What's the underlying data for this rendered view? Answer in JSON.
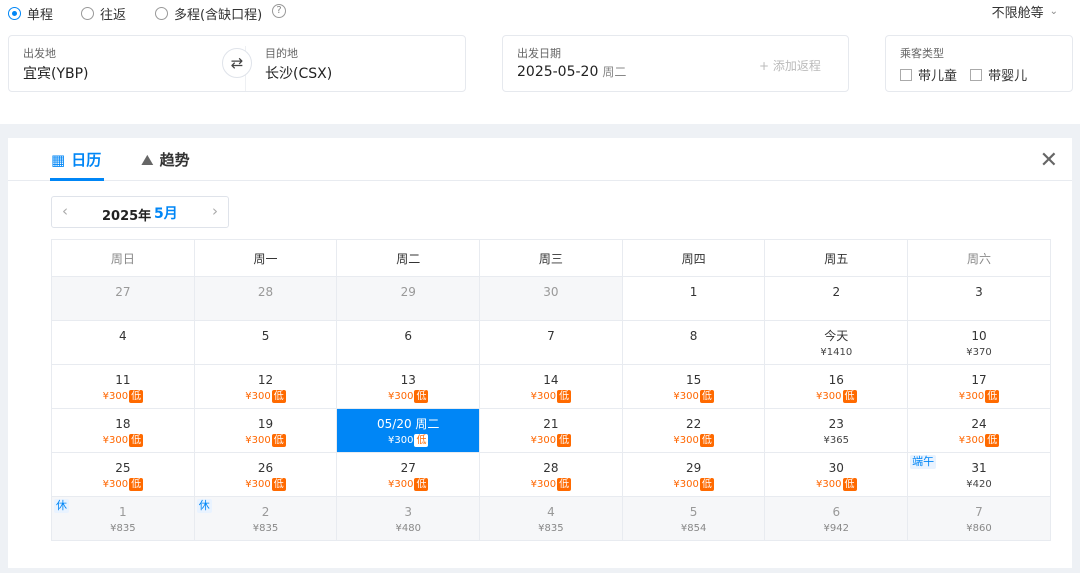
{
  "trip_types": [
    {
      "label": "单程",
      "checked": true
    },
    {
      "label": "往返",
      "checked": false
    },
    {
      "label": "多程(含缺口程)",
      "checked": false
    }
  ],
  "help_glyph": "?",
  "cabin": {
    "label": "不限舱等",
    "chevron": "⌄"
  },
  "search": {
    "origin_label": "出发地",
    "origin_value": "宜宾(YBP)",
    "dest_label": "目的地",
    "dest_value": "长沙(CSX)",
    "swap_glyph": "⇄",
    "date_label": "出发日期",
    "date_value": "2025-05-20",
    "date_weekday": "周二",
    "add_return": "+ 添加返程",
    "passenger_label": "乘客类型",
    "child": "带儿童",
    "infant": "带婴儿"
  },
  "calendar": {
    "tabs": [
      {
        "label": "日历",
        "icon": "calendar-icon",
        "glyph": "▦"
      },
      {
        "label": "趋势",
        "icon": "trend-icon",
        "glyph": "⛰"
      }
    ],
    "close_glyph": "✕",
    "nav": {
      "prev": "‹",
      "next": "›",
      "year": "2025年",
      "month": "5月"
    },
    "weekdays": [
      "周日",
      "周一",
      "周二",
      "周三",
      "周四",
      "周五",
      "周六"
    ],
    "low_badge": "低",
    "weeks": [
      [
        {
          "d": "27",
          "outside": true
        },
        {
          "d": "28",
          "outside": true
        },
        {
          "d": "29",
          "outside": true
        },
        {
          "d": "30",
          "outside": true
        },
        {
          "d": "1"
        },
        {
          "d": "2"
        },
        {
          "d": "3"
        }
      ],
      [
        {
          "d": "4"
        },
        {
          "d": "5"
        },
        {
          "d": "6"
        },
        {
          "d": "7"
        },
        {
          "d": "8"
        },
        {
          "d": "今天",
          "p": "¥1410"
        },
        {
          "d": "10",
          "p": "¥370"
        }
      ],
      [
        {
          "d": "11",
          "p": "¥300",
          "low": true
        },
        {
          "d": "12",
          "p": "¥300",
          "low": true
        },
        {
          "d": "13",
          "p": "¥300",
          "low": true
        },
        {
          "d": "14",
          "p": "¥300",
          "low": true
        },
        {
          "d": "15",
          "p": "¥300",
          "low": true
        },
        {
          "d": "16",
          "p": "¥300",
          "low": true
        },
        {
          "d": "17",
          "p": "¥300",
          "low": true
        }
      ],
      [
        {
          "d": "18",
          "p": "¥300",
          "low": true
        },
        {
          "d": "19",
          "p": "¥300",
          "low": true
        },
        {
          "d": "05/20 周二",
          "p": "¥300",
          "low": true,
          "sel": true
        },
        {
          "d": "21",
          "p": "¥300",
          "low": true
        },
        {
          "d": "22",
          "p": "¥300",
          "low": true
        },
        {
          "d": "23",
          "p": "¥365"
        },
        {
          "d": "24",
          "p": "¥300",
          "low": true
        }
      ],
      [
        {
          "d": "25",
          "p": "¥300",
          "low": true
        },
        {
          "d": "26",
          "p": "¥300",
          "low": true
        },
        {
          "d": "27",
          "p": "¥300",
          "low": true
        },
        {
          "d": "28",
          "p": "¥300",
          "low": true
        },
        {
          "d": "29",
          "p": "¥300",
          "low": true
        },
        {
          "d": "30",
          "p": "¥300",
          "low": true
        },
        {
          "d": "31",
          "p": "¥420",
          "tag": "端午"
        }
      ],
      [
        {
          "d": "1",
          "p": "¥835",
          "outside": true,
          "tag": "休"
        },
        {
          "d": "2",
          "p": "¥835",
          "outside": true,
          "tag": "休"
        },
        {
          "d": "3",
          "p": "¥480",
          "outside": true
        },
        {
          "d": "4",
          "p": "¥835",
          "outside": true
        },
        {
          "d": "5",
          "p": "¥854",
          "outside": true
        },
        {
          "d": "6",
          "p": "¥942",
          "outside": true
        },
        {
          "d": "7",
          "p": "¥860",
          "outside": true
        }
      ]
    ]
  }
}
